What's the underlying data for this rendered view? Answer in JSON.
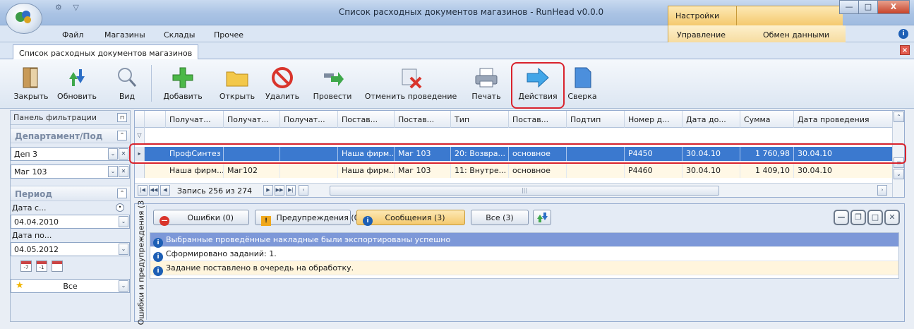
{
  "window": {
    "title": "Список расходных документов магазинов - RunHead v0.0.0",
    "settings_tab": "Настройки",
    "minimize": "—",
    "maximize": "□",
    "close": "X"
  },
  "menu": {
    "items": [
      "Файл",
      "Магазины",
      "Склады",
      "Прочее"
    ],
    "secondary": [
      "Управление",
      "Обмен данными"
    ]
  },
  "doc_tab": "Список расходных документов магазинов",
  "toolbar": {
    "buttons": [
      "Закрыть",
      "Обновить",
      "Вид",
      "Добавить",
      "Открыть",
      "Удалить",
      "Провести",
      "Отменить проведение",
      "Печать",
      "Действия",
      "Сверка"
    ]
  },
  "filter_panel": {
    "title": "Панель фильтрации",
    "group_department": "Департамент/Под",
    "department_value": "Деп 3",
    "store_value": "Маг 103",
    "group_period": "Период",
    "date_from_label": "Дата с...",
    "date_from_value": "04.04.2010",
    "date_to_label": "Дата по...",
    "date_to_value": "04.05.2012",
    "cal_labels": [
      "-7",
      "-1",
      ""
    ],
    "favorite_value": "Все"
  },
  "grid": {
    "columns": [
      "Получат...",
      "Получат...",
      "Получат...",
      "Постав...",
      "Постав...",
      "Тип",
      "Постав...",
      "Подтип",
      "Номер д...",
      "Дата до...",
      "Сумма",
      "Дата проведения"
    ],
    "rows": [
      [
        "ПрофСинтез",
        "",
        "",
        "Наша фирм...",
        "Маг 103",
        "20: Возвра...",
        "основное",
        "",
        "Р4450",
        "30.04.10",
        "1 760,98",
        "30.04.10"
      ],
      [
        "Наша фирм...",
        "Маг102",
        "",
        "Наша фирм...",
        "Маг 103",
        "11: Внутре...",
        "основное",
        "",
        "Р4460",
        "30.04.10",
        "1 409,10",
        "30.04.10"
      ]
    ],
    "record_info": "Запись 256 из 274"
  },
  "messages": {
    "panel_title": "Ошибки и предупреждения (3",
    "btn_errors": "Ошибки (0)",
    "btn_warnings": "Предупреждения (0)",
    "btn_messages": "Сообщения (3)",
    "btn_all": "Все (3)",
    "items": [
      "Выбранные проведённые накладные были экспортированы успешно",
      "Сформировано заданий: 1.",
      "Задание поставлено в очередь на обработку."
    ]
  },
  "colors": {
    "selected_row": "#3b79cf",
    "highlight_frame": "#d9232d",
    "accent_tab": "#f4c96e"
  }
}
